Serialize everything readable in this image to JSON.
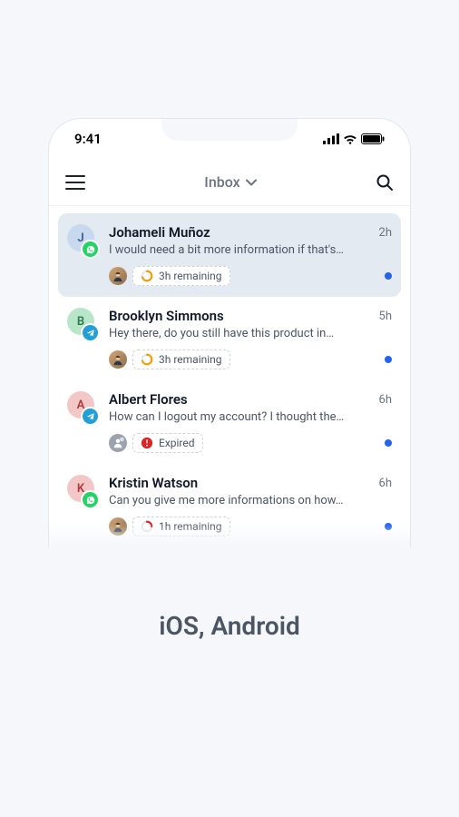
{
  "status": {
    "time": "9:41"
  },
  "navbar": {
    "title": "Inbox"
  },
  "conversations": [
    {
      "initial": "J",
      "avatar_bg": "#c7d9ee",
      "avatar_fg": "#3b5c8a",
      "channel": "whatsapp",
      "name": "Johameli Muñoz",
      "time": "2h",
      "preview": "I would need a bit more information if that's…",
      "assignee": "user",
      "sla_label": "3h remaining",
      "sla_color": "#f59e0b",
      "sla_fraction": 0.7,
      "expired": false,
      "selected": true
    },
    {
      "initial": "B",
      "avatar_bg": "#b8e6c9",
      "avatar_fg": "#2f7a4a",
      "channel": "telegram",
      "name": "Brooklyn Simmons",
      "time": "5h",
      "preview": "Hey there, do you still have this product in…",
      "assignee": "user",
      "sla_label": "3h remaining",
      "sla_color": "#f59e0b",
      "sla_fraction": 0.7,
      "expired": false,
      "selected": false
    },
    {
      "initial": "A",
      "avatar_bg": "#f4c7c7",
      "avatar_fg": "#b03a3a",
      "channel": "telegram",
      "name": "Albert Flores",
      "time": "6h",
      "preview": "How can I logout my account? I thought the…",
      "assignee": "unassigned",
      "sla_label": "Expired",
      "sla_color": "#dc2626",
      "sla_fraction": 1,
      "expired": true,
      "selected": false
    },
    {
      "initial": "K",
      "avatar_bg": "#f4c7c7",
      "avatar_fg": "#b03a3a",
      "channel": "whatsapp",
      "name": "Kristin Watson",
      "time": "6h",
      "preview": "Can you give me more informations on how…",
      "assignee": "user",
      "sla_label": "1h remaining",
      "sla_color": "#dc2626",
      "sla_fraction": 0.25,
      "expired": false,
      "selected": false
    }
  ],
  "footer": {
    "label": "iOS, Android"
  }
}
